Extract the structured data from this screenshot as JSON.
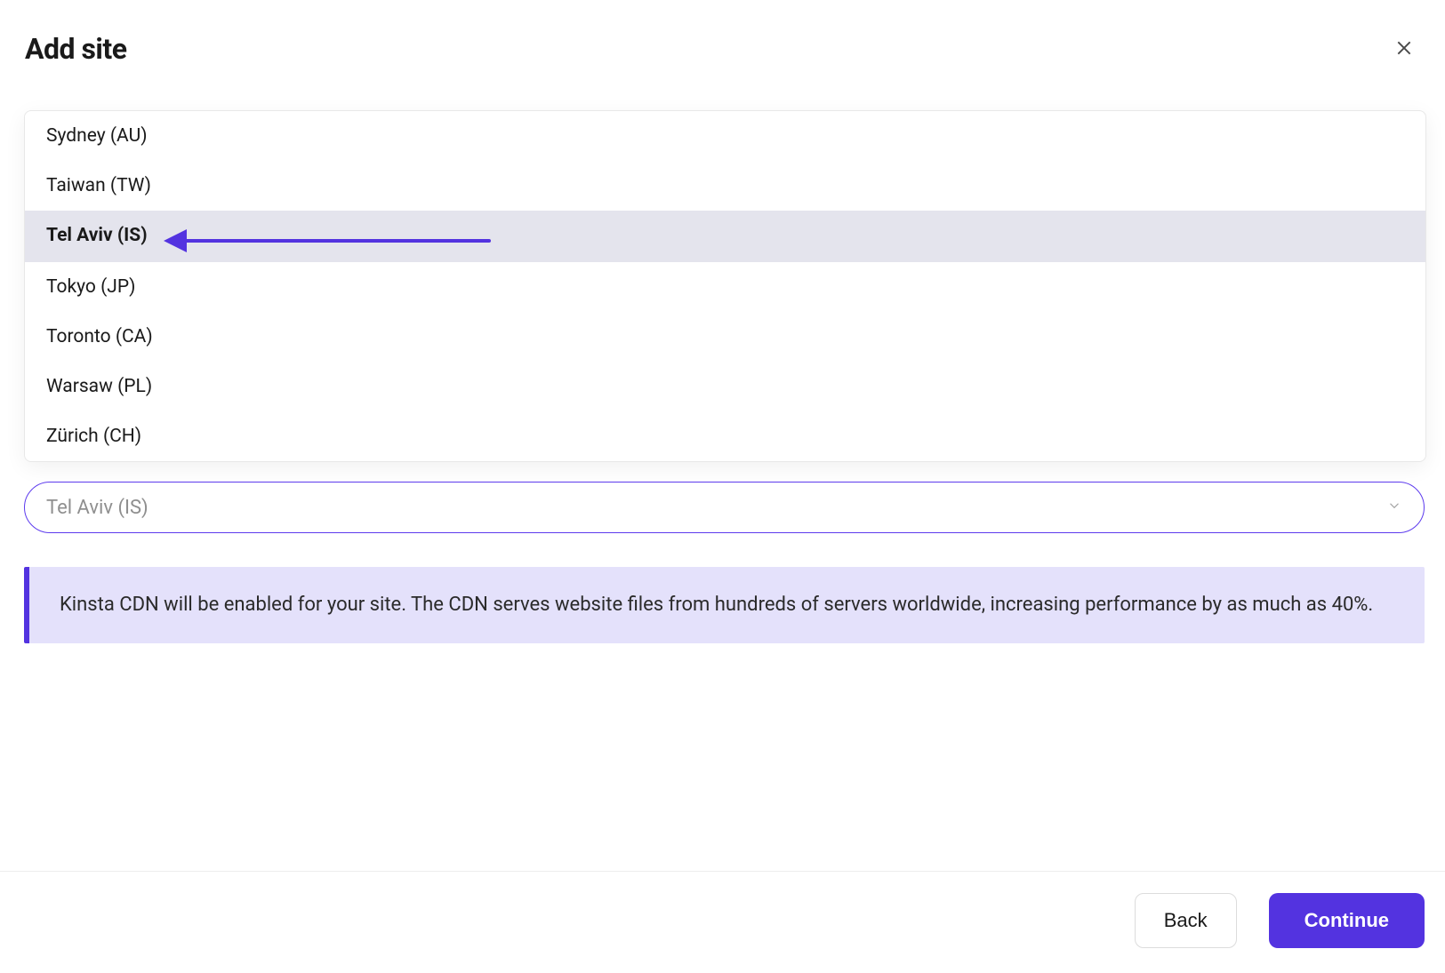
{
  "header": {
    "title": "Add site"
  },
  "dropdown": {
    "items": [
      {
        "label": "Sydney (AU)",
        "highlighted": false
      },
      {
        "label": "Taiwan (TW)",
        "highlighted": false
      },
      {
        "label": "Tel Aviv (IS)",
        "highlighted": true
      },
      {
        "label": "Tokyo (JP)",
        "highlighted": false
      },
      {
        "label": "Toronto (CA)",
        "highlighted": false
      },
      {
        "label": "Warsaw (PL)",
        "highlighted": false
      },
      {
        "label": "Zürich (CH)",
        "highlighted": false
      }
    ]
  },
  "select": {
    "value": "Tel Aviv (IS)"
  },
  "info": {
    "text": "Kinsta CDN will be enabled for your site. The CDN serves website files from hundreds of servers worldwide, increasing performance by as much as 40%."
  },
  "footer": {
    "back": "Back",
    "continue": "Continue"
  }
}
